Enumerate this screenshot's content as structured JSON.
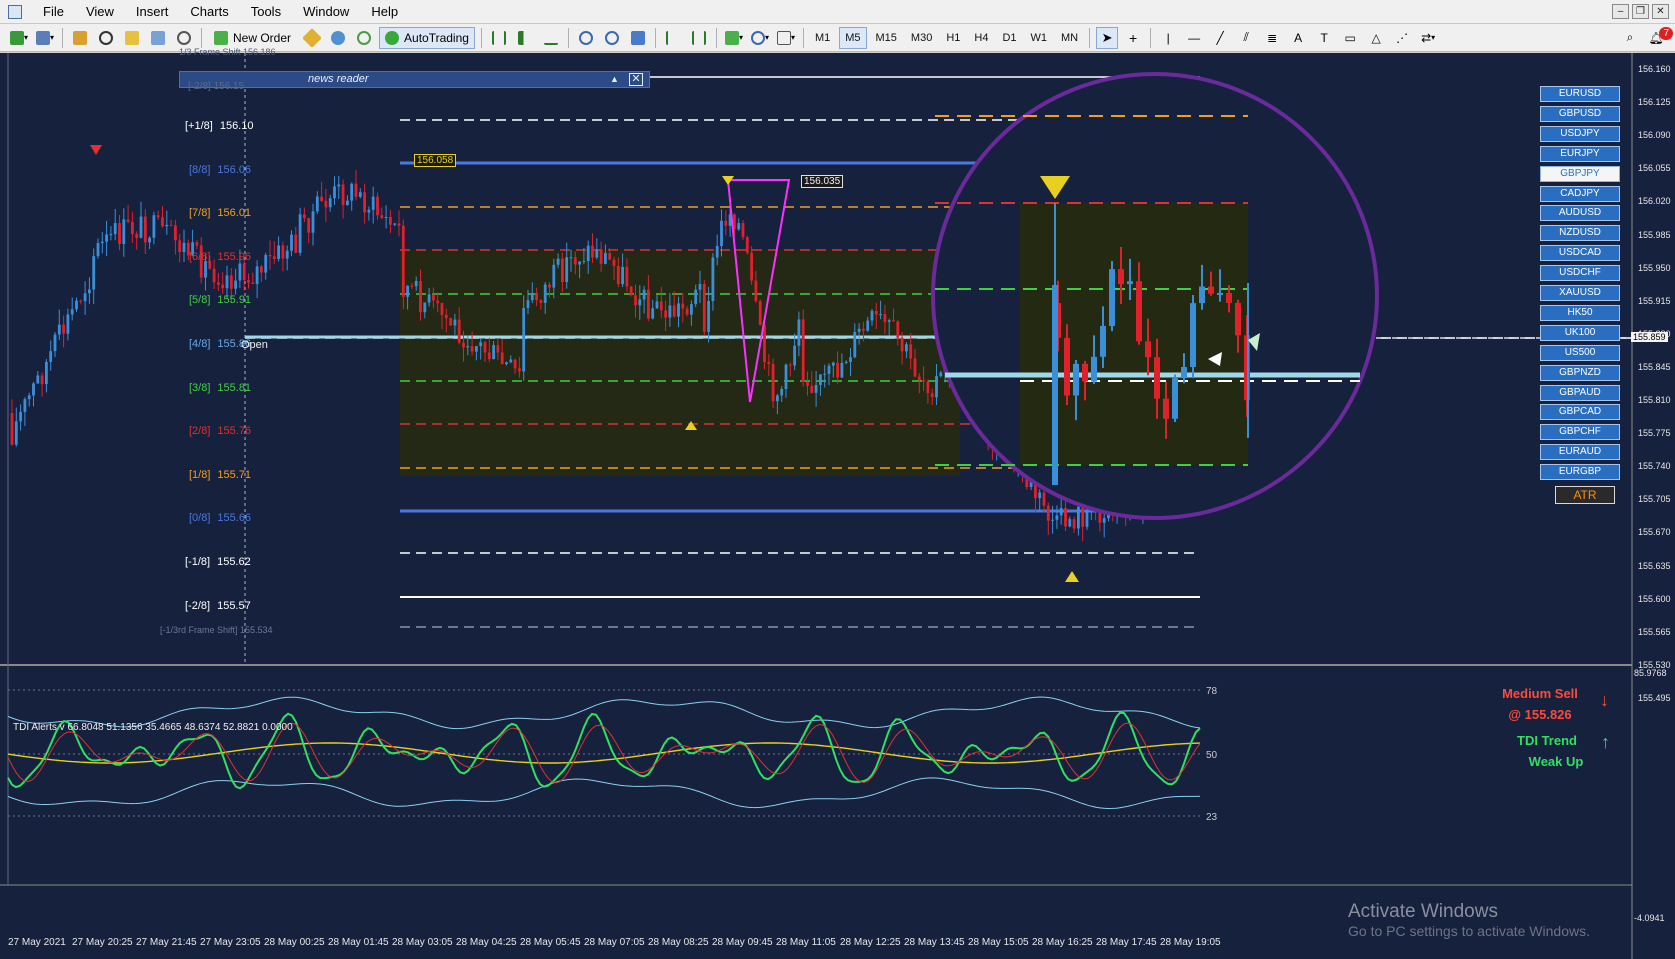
{
  "menu": {
    "items": [
      "File",
      "View",
      "Insert",
      "Charts",
      "Tools",
      "Window",
      "Help"
    ]
  },
  "toolbar": {
    "new_order_label": "New Order",
    "autotrading_label": "AutoTrading",
    "timeframes": [
      "M1",
      "M5",
      "M15",
      "M30",
      "H1",
      "H4",
      "D1",
      "W1",
      "MN"
    ],
    "active_timeframe": "M5",
    "notification_count": "7"
  },
  "chart": {
    "news_reader_title": "news reader",
    "levels": [
      {
        "tag": "[+1/8]",
        "value": "156.10",
        "color": "#ffffff"
      },
      {
        "tag": "[8/8]",
        "value": "156.06",
        "color": "#4a78e0"
      },
      {
        "tag": "[7/8]",
        "value": "156.01",
        "color": "#f0a020"
      },
      {
        "tag": "[6/8]",
        "value": "155.96",
        "color": "#e03030"
      },
      {
        "tag": "[5/8]",
        "value": "155.91",
        "color": "#40d040"
      },
      {
        "tag": "[4/8]",
        "value": "155.86",
        "color": "#6aa8e8"
      },
      {
        "tag": "[3/8]",
        "value": "155.81",
        "color": "#40d040"
      },
      {
        "tag": "[2/8]",
        "value": "155.76",
        "color": "#e03030"
      },
      {
        "tag": "[1/8]",
        "value": "155.71",
        "color": "#f0a020"
      },
      {
        "tag": "[0/8]",
        "value": "155.66",
        "color": "#4a78e0"
      },
      {
        "tag": "[-1/8]",
        "value": "155.62",
        "color": "#ffffff"
      },
      {
        "tag": "[-2/8]",
        "value": "155.57",
        "color": "#ffffff"
      }
    ],
    "top_frame_label": "[-2/8]  156.15",
    "frame_shift_top": "1/3 Frame Shift  156.186",
    "frame_shift_bottom": "[-1/3rd Frame Shift]  155.534",
    "open_label": "Open",
    "box_label_high": "156.058",
    "zigzag_label": "156.035",
    "current_price": "155.859",
    "price_axis": [
      "156.160",
      "156.125",
      "156.090",
      "156.055",
      "156.020",
      "155.985",
      "155.950",
      "155.915",
      "155.880",
      "155.845",
      "155.810",
      "155.775",
      "155.740",
      "155.705",
      "155.670",
      "155.635",
      "155.600",
      "155.565",
      "155.530",
      "155.495"
    ],
    "time_axis": [
      "27 May 2021",
      "27 May 20:25",
      "27 May 21:45",
      "27 May 23:05",
      "28 May 00:25",
      "28 May 01:45",
      "28 May 03:05",
      "28 May 04:25",
      "28 May 05:45",
      "28 May 07:05",
      "28 May 08:25",
      "28 May 09:45",
      "28 May 11:05",
      "28 May 12:25",
      "28 May 13:45",
      "28 May 15:05",
      "28 May 16:25",
      "28 May 17:45",
      "28 May 19:05"
    ],
    "pairs": [
      "EURUSD",
      "GBPUSD",
      "USDJPY",
      "EURJPY",
      "GBPJPY",
      "CADJPY",
      "AUDUSD",
      "NZDUSD",
      "USDCAD",
      "USDCHF",
      "XAUUSD",
      "HK50",
      "UK100",
      "US500",
      "GBPNZD",
      "GBPAUD",
      "GBPCAD",
      "GBPCHF",
      "EURAUD",
      "EURGBP"
    ],
    "active_pair": "GBPJPY",
    "atr_label": "ATR"
  },
  "tdi": {
    "title": "TDI Alerts v 66.8048 51.1356 35.4665 48.6374 52.8821 0.0000",
    "axis_top": "85.9768",
    "axis_bottom": "-4.0941",
    "level_78": "78",
    "level_50": "50",
    "level_23": "23",
    "signal_line1": "Medium Sell",
    "signal_line2": "@ 155.826",
    "trend_line1": "TDI Trend",
    "trend_line2": "Weak Up"
  },
  "watermark": {
    "line1": "Activate Windows",
    "line2": "Go to PC settings to activate Windows."
  },
  "colors": {
    "chart_bg": "#16213e",
    "bull_candle": "#3b8fd9",
    "bear_candle": "#e0202a",
    "zigzag": "#ff30ff",
    "zoom_circle": "#6a2a9a",
    "tdi_green": "#30e060",
    "tdi_yellow": "#e8d020",
    "tdi_band": "#8ad0f0"
  }
}
